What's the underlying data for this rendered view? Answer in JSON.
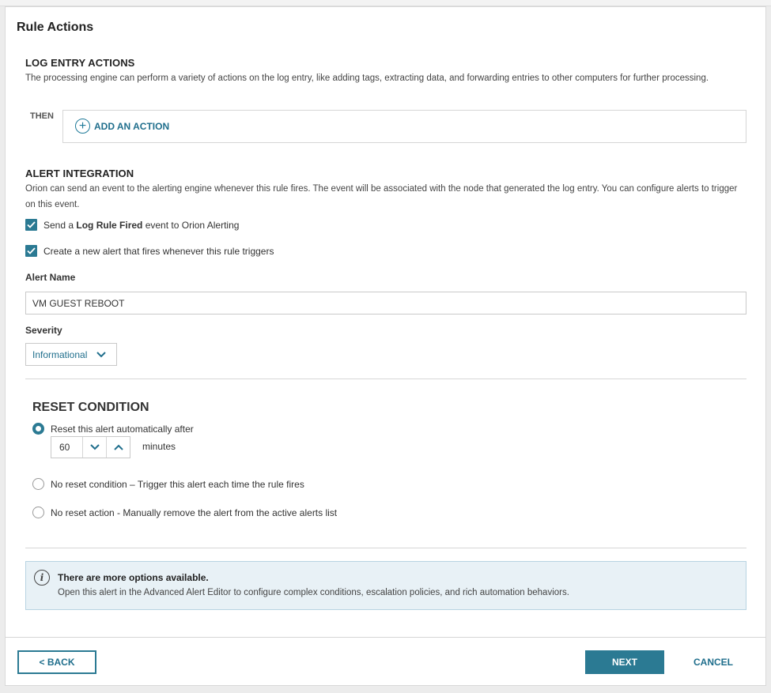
{
  "page": {
    "title": "Rule Actions"
  },
  "log_entry_actions": {
    "title": "LOG ENTRY ACTIONS",
    "description": "The processing engine can perform a variety of actions on the log entry, like adding tags, extracting data, and forwarding entries to other computers for further processing.",
    "then_label": "THEN",
    "add_action_label": "ADD AN ACTION",
    "add_icon": "plus-circle-icon"
  },
  "alert_integration": {
    "title": "ALERT INTEGRATION",
    "description": "Orion can send an event to the alerting engine whenever this rule fires. The event will be associated with the node that generated the log entry. You can configure alerts to trigger on this event.",
    "send_event": {
      "prefix": "Send a ",
      "bold": "Log Rule Fired",
      "suffix": " event to Orion Alerting",
      "checked": true
    },
    "create_alert": {
      "label": "Create a new alert that fires whenever this rule triggers",
      "checked": true
    },
    "alert_name_label": "Alert Name",
    "alert_name_value": "VM GUEST REBOOT",
    "severity_label": "Severity",
    "severity_value": "Informational"
  },
  "reset_condition": {
    "title": "RESET CONDITION",
    "options": [
      {
        "label": "Reset this alert automatically after",
        "selected": true
      },
      {
        "label": "No reset condition – Trigger this alert each time the rule fires",
        "selected": false
      },
      {
        "label": "No reset action - Manually remove the alert from the active alerts list",
        "selected": false
      }
    ],
    "minutes_value": "60",
    "minutes_label": "minutes"
  },
  "info": {
    "title": "There are more options available.",
    "text": "Open this alert in the Advanced Alert Editor to configure complex conditions, escalation policies, and rich automation behaviors.",
    "icon": "info-icon"
  },
  "footer": {
    "back_label": "< BACK",
    "next_label": "NEXT",
    "cancel_label": "CANCEL"
  },
  "colors": {
    "accent": "#2b7a93",
    "link": "#1f6e8c",
    "info_bg": "#e8f1f6"
  }
}
